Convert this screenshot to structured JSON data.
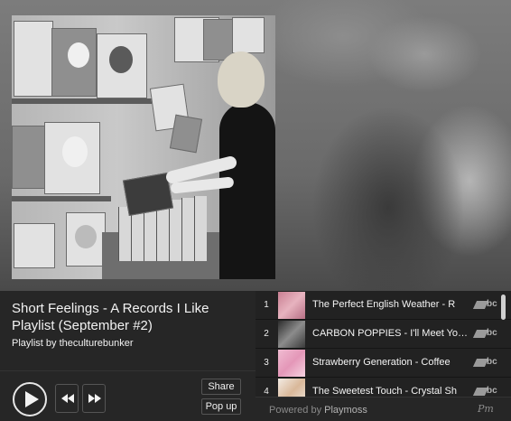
{
  "playlist": {
    "title": "Short Feelings - A Records I Like Playlist (September #2)",
    "byline": "Playlist by theculturebunker"
  },
  "controls": {
    "share_label": "Share",
    "popup_label": "Pop up"
  },
  "tracks": [
    {
      "number": "1",
      "name": "The Perfect English Weather - R",
      "thumb_color": "#d79aa8",
      "source": "bc"
    },
    {
      "number": "2",
      "name": "CARBON POPPIES - I'll Meet You ...",
      "thumb_color": "#4a4a4a",
      "source": "bc"
    },
    {
      "number": "3",
      "name": "Strawberry Generation - Coffee",
      "thumb_color": "#e6a7c2",
      "source": "bc"
    },
    {
      "number": "4",
      "name": "The Sweetest Touch - Crystal Sh",
      "thumb_color": "#e9e1d8",
      "source": "bc"
    }
  ],
  "footer": {
    "powered_prefix": "Powered by",
    "powered_brand": "Playmoss",
    "logo_text": "Pm"
  },
  "icons": {
    "play": "play-icon",
    "rewind": "rewind-icon",
    "fast_forward": "fast-forward-icon",
    "source": "bandcamp-icon"
  }
}
